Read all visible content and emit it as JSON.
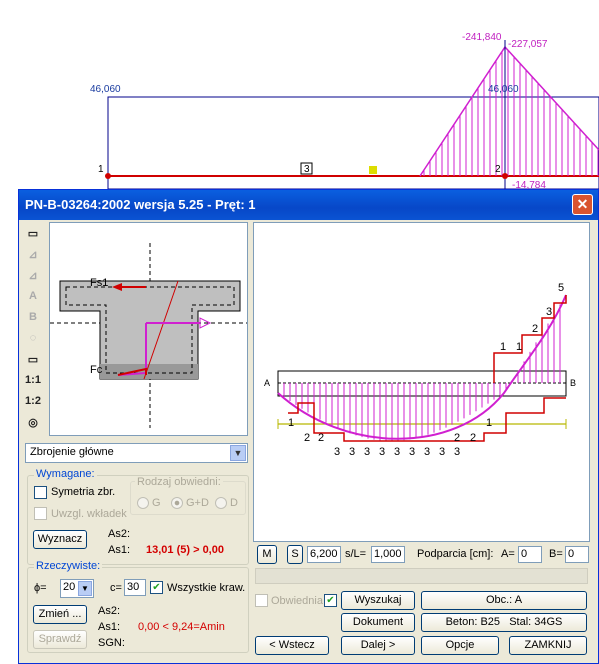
{
  "background": {
    "labels_blue": [
      "46,060",
      "46,060"
    ],
    "labels_magenta": [
      "-241,840",
      "-227,057",
      "-14,784"
    ],
    "node_labels": [
      "1",
      "2",
      "3"
    ]
  },
  "window": {
    "title": "PN-B-03264:2002 wersja 5.25 - Pręt: 1",
    "close_label": "✕"
  },
  "toolbar": {
    "ratio1": "1:1",
    "ratio2": "1:2"
  },
  "section": {
    "label_fs1": "Fs1",
    "label_fc": "Fc"
  },
  "beam": {
    "label_a": "A",
    "label_b": "B",
    "top_counts": [
      "1",
      "1",
      "2",
      "3",
      "5"
    ],
    "bottom_side_counts": [
      "1",
      "2",
      "2",
      "2",
      "2",
      "1"
    ],
    "bottom_counts": [
      "3",
      "3",
      "3",
      "3",
      "3",
      "3",
      "3",
      "3",
      "3"
    ]
  },
  "combo": {
    "value": "Zbrojenie główne",
    "arrow": "▼"
  },
  "wymagane": {
    "legend": "Wymagane:",
    "symetria": "Symetria zbr.",
    "uwzgl": "Uwzgl. wkładek",
    "rodzaj": "Rodzaj obwiedni:",
    "radio_g": "G",
    "radio_gd": "G+D",
    "radio_d": "D",
    "wyznacz": "Wyznacz",
    "as2_label": "As2:",
    "as1_label": "As1:",
    "as1_value": "13,01 (5) > 0,00"
  },
  "rzeczywiste": {
    "legend": "Rzeczywiste:",
    "phi_label": "ϕ=",
    "phi_value": "20",
    "c_label": "c=",
    "c_value": "30",
    "wszystkie": "Wszystkie kraw.",
    "zmien": "Zmień ...",
    "sprawdz": "Sprawdź",
    "as2_label": "As2:",
    "as1_label": "As1:",
    "as1_value": "0,00 < 9,24=Amin",
    "sgn_label": "SGN:"
  },
  "controls": {
    "m_btn": "M",
    "s_btn": "S",
    "s_value": "6,200",
    "sl_label": "s/L=",
    "sl_value": "1,000",
    "podparcia": "Podparcia [cm]:",
    "a_label": "A=",
    "a_value": "0",
    "b_label": "B=",
    "b_value": "0",
    "obwiednia": "Obwiednia",
    "wyszukaj": "Wyszukaj",
    "obc": "Obc.: A",
    "dokument": "Dokument",
    "beton": "Beton: B25",
    "stal": "Stal: 34GS",
    "wstecz": "< Wstecz",
    "dalej": "Dalej >",
    "opcje": "Opcje",
    "zamknij": "ZAMKNIJ"
  }
}
